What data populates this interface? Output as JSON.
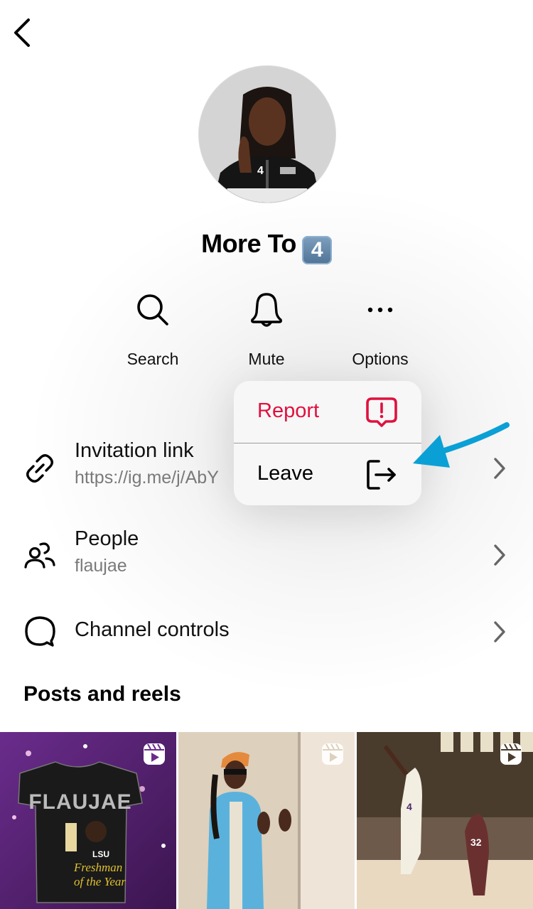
{
  "header": {
    "back_icon": "chevron-left-icon",
    "channel_name": "More To",
    "channel_emoji": "4"
  },
  "actions": [
    {
      "label": "Search",
      "icon": "search-icon"
    },
    {
      "label": "Mute",
      "icon": "bell-icon"
    },
    {
      "label": "Options",
      "icon": "more-horizontal-icon"
    }
  ],
  "settings": [
    {
      "title": "Invitation link",
      "subtitle": "https://ig.me/j/AbY",
      "icon": "link-icon"
    },
    {
      "title": "People",
      "subtitle": "flaujae",
      "icon": "people-icon"
    },
    {
      "title": "Channel controls",
      "subtitle": "",
      "icon": "chat-bubble-icon"
    }
  ],
  "options_menu": {
    "items": [
      {
        "label": "Report",
        "icon": "report-icon",
        "color": "#e0113f"
      },
      {
        "label": "Leave",
        "icon": "leave-icon",
        "color": "#000000"
      }
    ]
  },
  "posts": {
    "title": "Posts and reels",
    "items": [
      {
        "type": "reel",
        "description": "FLAUJAE LSU Freshman of the Year t-shirt",
        "caption_text": "FLAUJAE · LSU · Freshman of the Year"
      },
      {
        "type": "reel",
        "description": "Person in orange cap and blue jacket"
      },
      {
        "type": "reel",
        "description": "Basketball game, player #4 shooting, opponent #32"
      }
    ]
  },
  "annotation": {
    "arrow_color": "#0aa0d6",
    "points_to": "Leave"
  }
}
